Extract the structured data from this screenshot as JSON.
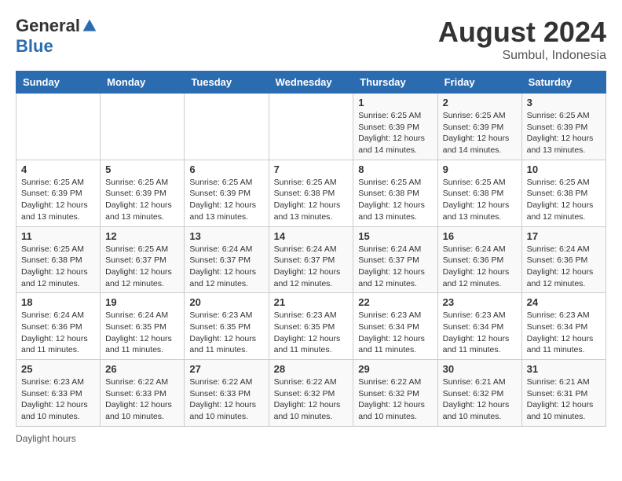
{
  "logo": {
    "general": "General",
    "blue": "Blue"
  },
  "header": {
    "month_year": "August 2024",
    "location": "Sumbul, Indonesia"
  },
  "days_of_week": [
    "Sunday",
    "Monday",
    "Tuesday",
    "Wednesday",
    "Thursday",
    "Friday",
    "Saturday"
  ],
  "weeks": [
    [
      {
        "day": "",
        "info": ""
      },
      {
        "day": "",
        "info": ""
      },
      {
        "day": "",
        "info": ""
      },
      {
        "day": "",
        "info": ""
      },
      {
        "day": "1",
        "info": "Sunrise: 6:25 AM\nSunset: 6:39 PM\nDaylight: 12 hours and 14 minutes."
      },
      {
        "day": "2",
        "info": "Sunrise: 6:25 AM\nSunset: 6:39 PM\nDaylight: 12 hours and 14 minutes."
      },
      {
        "day": "3",
        "info": "Sunrise: 6:25 AM\nSunset: 6:39 PM\nDaylight: 12 hours and 13 minutes."
      }
    ],
    [
      {
        "day": "4",
        "info": "Sunrise: 6:25 AM\nSunset: 6:39 PM\nDaylight: 12 hours and 13 minutes."
      },
      {
        "day": "5",
        "info": "Sunrise: 6:25 AM\nSunset: 6:39 PM\nDaylight: 12 hours and 13 minutes."
      },
      {
        "day": "6",
        "info": "Sunrise: 6:25 AM\nSunset: 6:39 PM\nDaylight: 12 hours and 13 minutes."
      },
      {
        "day": "7",
        "info": "Sunrise: 6:25 AM\nSunset: 6:38 PM\nDaylight: 12 hours and 13 minutes."
      },
      {
        "day": "8",
        "info": "Sunrise: 6:25 AM\nSunset: 6:38 PM\nDaylight: 12 hours and 13 minutes."
      },
      {
        "day": "9",
        "info": "Sunrise: 6:25 AM\nSunset: 6:38 PM\nDaylight: 12 hours and 13 minutes."
      },
      {
        "day": "10",
        "info": "Sunrise: 6:25 AM\nSunset: 6:38 PM\nDaylight: 12 hours and 12 minutes."
      }
    ],
    [
      {
        "day": "11",
        "info": "Sunrise: 6:25 AM\nSunset: 6:38 PM\nDaylight: 12 hours and 12 minutes."
      },
      {
        "day": "12",
        "info": "Sunrise: 6:25 AM\nSunset: 6:37 PM\nDaylight: 12 hours and 12 minutes."
      },
      {
        "day": "13",
        "info": "Sunrise: 6:24 AM\nSunset: 6:37 PM\nDaylight: 12 hours and 12 minutes."
      },
      {
        "day": "14",
        "info": "Sunrise: 6:24 AM\nSunset: 6:37 PM\nDaylight: 12 hours and 12 minutes."
      },
      {
        "day": "15",
        "info": "Sunrise: 6:24 AM\nSunset: 6:37 PM\nDaylight: 12 hours and 12 minutes."
      },
      {
        "day": "16",
        "info": "Sunrise: 6:24 AM\nSunset: 6:36 PM\nDaylight: 12 hours and 12 minutes."
      },
      {
        "day": "17",
        "info": "Sunrise: 6:24 AM\nSunset: 6:36 PM\nDaylight: 12 hours and 12 minutes."
      }
    ],
    [
      {
        "day": "18",
        "info": "Sunrise: 6:24 AM\nSunset: 6:36 PM\nDaylight: 12 hours and 11 minutes."
      },
      {
        "day": "19",
        "info": "Sunrise: 6:24 AM\nSunset: 6:35 PM\nDaylight: 12 hours and 11 minutes."
      },
      {
        "day": "20",
        "info": "Sunrise: 6:23 AM\nSunset: 6:35 PM\nDaylight: 12 hours and 11 minutes."
      },
      {
        "day": "21",
        "info": "Sunrise: 6:23 AM\nSunset: 6:35 PM\nDaylight: 12 hours and 11 minutes."
      },
      {
        "day": "22",
        "info": "Sunrise: 6:23 AM\nSunset: 6:34 PM\nDaylight: 12 hours and 11 minutes."
      },
      {
        "day": "23",
        "info": "Sunrise: 6:23 AM\nSunset: 6:34 PM\nDaylight: 12 hours and 11 minutes."
      },
      {
        "day": "24",
        "info": "Sunrise: 6:23 AM\nSunset: 6:34 PM\nDaylight: 12 hours and 11 minutes."
      }
    ],
    [
      {
        "day": "25",
        "info": "Sunrise: 6:23 AM\nSunset: 6:33 PM\nDaylight: 12 hours and 10 minutes."
      },
      {
        "day": "26",
        "info": "Sunrise: 6:22 AM\nSunset: 6:33 PM\nDaylight: 12 hours and 10 minutes."
      },
      {
        "day": "27",
        "info": "Sunrise: 6:22 AM\nSunset: 6:33 PM\nDaylight: 12 hours and 10 minutes."
      },
      {
        "day": "28",
        "info": "Sunrise: 6:22 AM\nSunset: 6:32 PM\nDaylight: 12 hours and 10 minutes."
      },
      {
        "day": "29",
        "info": "Sunrise: 6:22 AM\nSunset: 6:32 PM\nDaylight: 12 hours and 10 minutes."
      },
      {
        "day": "30",
        "info": "Sunrise: 6:21 AM\nSunset: 6:32 PM\nDaylight: 12 hours and 10 minutes."
      },
      {
        "day": "31",
        "info": "Sunrise: 6:21 AM\nSunset: 6:31 PM\nDaylight: 12 hours and 10 minutes."
      }
    ]
  ],
  "footer": {
    "daylight_label": "Daylight hours"
  }
}
